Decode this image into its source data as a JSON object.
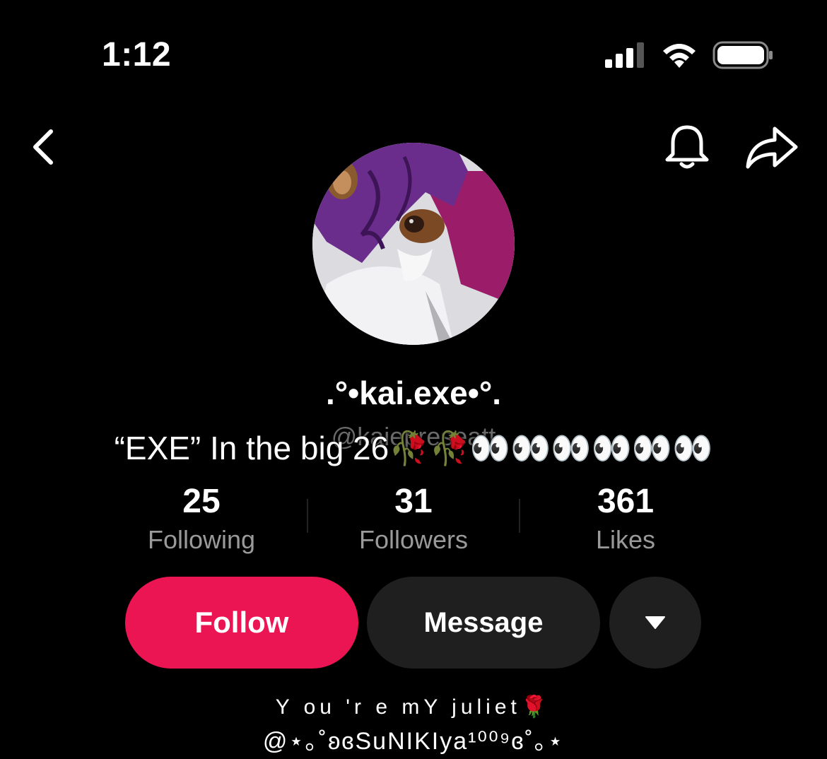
{
  "status_bar": {
    "time": "1:12"
  },
  "nav": {
    "back_icon": "chevron-left-icon",
    "bell_icon": "bell-icon",
    "share_icon": "share-arrow-icon"
  },
  "profile": {
    "display_name": ".°•kai.exe•°.",
    "username": "@kaiepreseatt",
    "bio_headline": "“EXE” In the big 26🥀🥀👀👀👀👀👀👀",
    "bio_line1": "Y ou 'r e mY juliet🌹",
    "bio_line2": "@⋆｡˚ʚɞSuNIKIya¹⁰⁰⁹ɞ˚｡⋆"
  },
  "stats": [
    {
      "value": "25",
      "label": "Following"
    },
    {
      "value": "31",
      "label": "Followers"
    },
    {
      "value": "361",
      "label": "Likes"
    }
  ],
  "actions": {
    "follow_label": "Follow",
    "message_label": "Message",
    "more_icon": "caret-down-icon"
  },
  "colors": {
    "follow_button": "#ec1553",
    "secondary_button": "#1f1f1f",
    "background": "#000000"
  }
}
